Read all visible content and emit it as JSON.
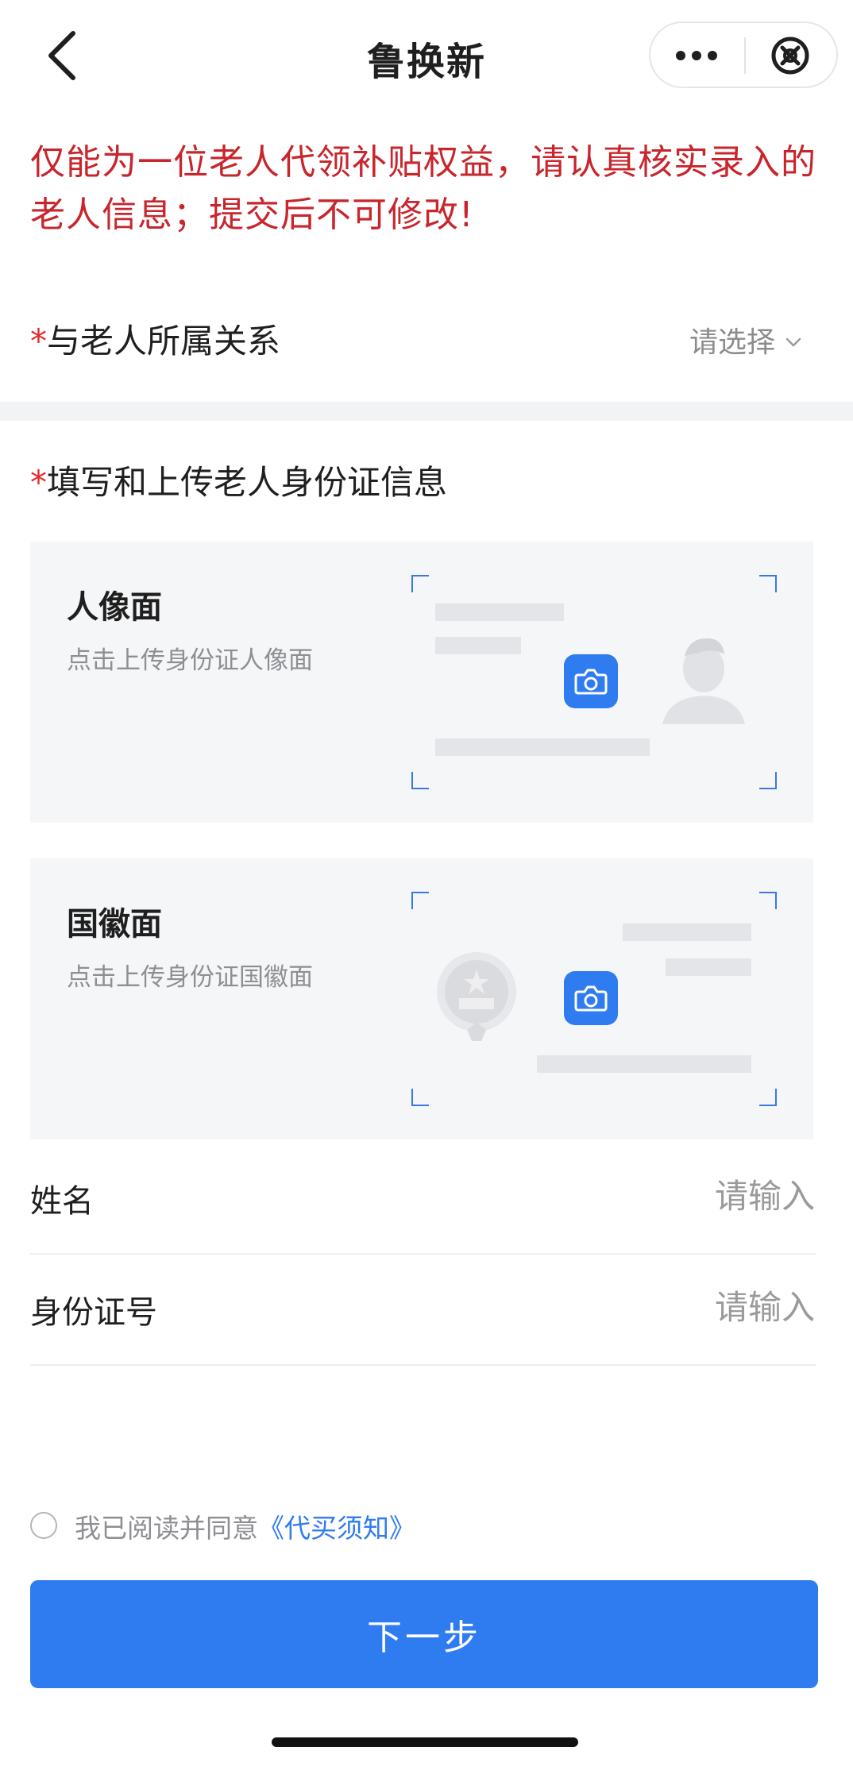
{
  "nav": {
    "title": "鲁换新"
  },
  "notice": "仅能为一位老人代领补贴权益，请认真核实录入的老人信息；提交后不可修改!",
  "relation": {
    "required_mark": "*",
    "label": "与老人所属关系",
    "placeholder": "请选择"
  },
  "id_section": {
    "required_mark": "*",
    "title": "填写和上传老人身份证信息",
    "cards": [
      {
        "title": "人像面",
        "subtitle": "点击上传身份证人像面",
        "icon": "camera-icon"
      },
      {
        "title": "国徽面",
        "subtitle": "点击上传身份证国徽面",
        "icon": "camera-icon"
      }
    ]
  },
  "fields": [
    {
      "label": "姓名",
      "placeholder": "请输入"
    },
    {
      "label": "身份证号",
      "placeholder": "请输入"
    }
  ],
  "agreement": {
    "text": "我已阅读并同意",
    "link": "《代买须知》",
    "checked": false
  },
  "next_button": {
    "label": "下一步"
  },
  "colors": {
    "accent": "#2f7bf0",
    "warning": "#c8252c",
    "required": "#e02b2b"
  }
}
